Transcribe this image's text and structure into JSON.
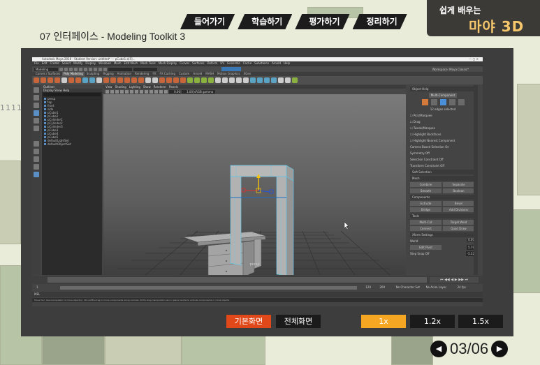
{
  "nav": {
    "tabs": [
      "들어가기",
      "학습하기",
      "평가하기",
      "정리하기"
    ],
    "brand_line1": "쉽게 배우는",
    "brand_line2": "마야 3D"
  },
  "lesson": {
    "title": "07 인터페이스 - Modeling Toolkit 3"
  },
  "maya": {
    "window_title": "Autodesk Maya 2016 - Student Version: untitled*  ---  pCube1.e[5]...",
    "menus": [
      "File",
      "Edit",
      "Create",
      "Select",
      "Modify",
      "Display",
      "Windows",
      "Mesh",
      "Edit Mesh",
      "Mesh Tools",
      "Mesh Display",
      "Curves",
      "Surfaces",
      "Deform",
      "UV",
      "Generate",
      "Cache",
      "Substance",
      "Arnold",
      "Help"
    ],
    "mode": "Modeling",
    "workspace": "Workspace: Maya Classic*",
    "shelf_tabs": [
      "Curves / Surfaces",
      "Poly Modeling",
      "Sculpting",
      "Rigging",
      "Animation",
      "Rendering",
      "FX",
      "FX Caching",
      "Custom",
      "Arnold",
      "MASH",
      "Motion Graphics",
      "XGen"
    ],
    "outliner": {
      "title": "Outliner",
      "menu": "Display  Show  Help",
      "items": [
        "persp",
        "top",
        "front",
        "side",
        "pCube1",
        "pCube2",
        "pCylinder1",
        "pCylinder2",
        "pCylinder3",
        "pCube3",
        "pCube4",
        "pCube5",
        "defaultLightSet",
        "defaultObjectSet"
      ]
    },
    "viewport": {
      "menus": [
        "View",
        "Shading",
        "Lighting",
        "Show",
        "Renderer",
        "Panels"
      ],
      "camera_label": "persp",
      "gamma": "sRGB gamma",
      "v1": "0.00",
      "v2": "1.00"
    },
    "toolkit": {
      "tabs": "Object  Help",
      "multi": "Multi-Component",
      "selected": "12 edges selected",
      "options": [
        "Pick/Marquee",
        "Drag",
        "Tweak/Marquee",
        "Highlight Backfaces",
        "Highlight Nearest Component"
      ],
      "camera_based": "Camera Based Selection  On",
      "symmetry": "Symmetry  Off",
      "sel_constraint": "Selection Constraint  Off",
      "transform_constraint": "Transform Constraint  Off",
      "soft_selection": "Soft Selection",
      "mesh_header": "Mesh",
      "mesh_buttons": [
        "Combine",
        "Separate",
        "Smooth",
        "Boolean"
      ],
      "components_header": "Components",
      "components_buttons": [
        "Extrude",
        "Bevel",
        "Bridge",
        "Add Divisions"
      ],
      "tools_header": "Tools",
      "tools_buttons": [
        "Multi-Cut",
        "Target Weld",
        "Connect",
        "Quad Draw"
      ],
      "xform_header": "Xform Settings",
      "world": "World",
      "edit_pivot": "Edit Pivot",
      "xyz": [
        "0.00",
        "5.79",
        "-5.32"
      ],
      "step_snap": "Step Snap  Off"
    },
    "time": {
      "start": "1",
      "end": "120",
      "range_end": "200",
      "char_set": "No Character Set",
      "anim_layer": "No Anim Layer",
      "fps": "24 fps"
    },
    "cmd": "MEL",
    "help": "Move Tool: Use manipulator to move object(s). Ctrl+LMB+drag to move components along normals. Shift+drag manipulator axis or plane handle to extrude components or clone objects."
  },
  "controls": {
    "basic": "기본화면",
    "full": "전체화면",
    "speeds": [
      "1x",
      "1.2x",
      "1.5x"
    ]
  },
  "pager": {
    "current": "03",
    "total": "06",
    "text": "03/06"
  },
  "deco": "1111"
}
